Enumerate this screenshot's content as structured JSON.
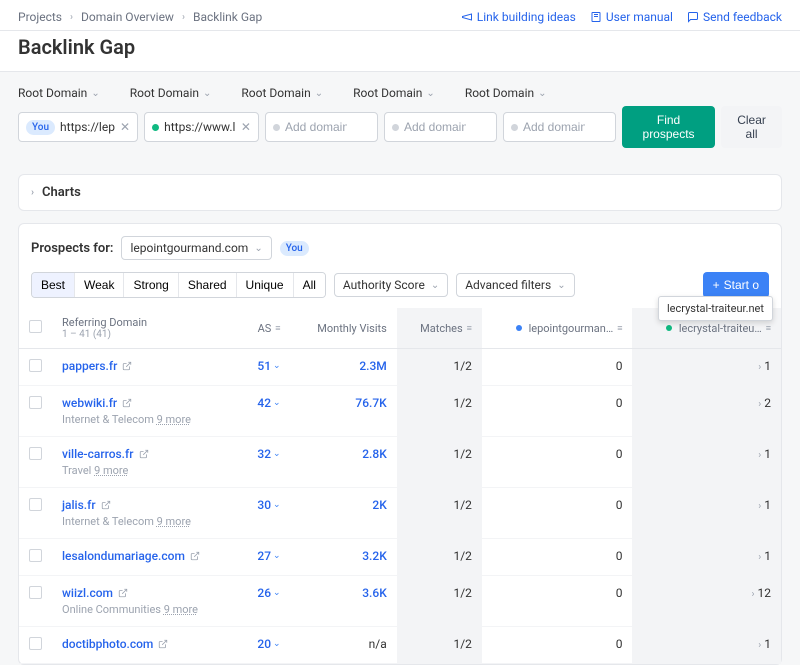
{
  "breadcrumbs": [
    "Projects",
    "Domain Overview",
    "Backlink Gap"
  ],
  "title": "Backlink Gap",
  "topLinks": {
    "ideas": "Link building ideas",
    "manual": "User manual",
    "feedback": "Send feedback"
  },
  "selectorLabel": "Root Domain",
  "youBadge": "You",
  "domainInputs": [
    {
      "value": "https://lep…",
      "filled": true,
      "color": "you"
    },
    {
      "value": "https://www.l…",
      "filled": true,
      "color": "green"
    },
    {
      "placeholder": "Add domain",
      "filled": false
    },
    {
      "placeholder": "Add domain",
      "filled": false
    },
    {
      "placeholder": "Add domain",
      "filled": false
    }
  ],
  "buttons": {
    "find": "Find prospects",
    "clear": "Clear all",
    "start": "Start o"
  },
  "chartsLabel": "Charts",
  "prospects": {
    "label": "Prospects for:",
    "domain": "lepointgourmand.com"
  },
  "segments": [
    "Best",
    "Weak",
    "Strong",
    "Shared",
    "Unique",
    "All"
  ],
  "filtersDD": {
    "authority": "Authority Score",
    "advanced": "Advanced filters"
  },
  "tooltip": "lecrystal-traiteur.net",
  "columns": {
    "domain": "Referring Domain",
    "domainSub": "1 – 41 (41)",
    "as": "AS",
    "visits": "Monthly Visits",
    "matches": "Matches",
    "c1": "lepointgourman…",
    "c2": "lecrystal-traiteu…"
  },
  "rows": [
    {
      "d": "pappers.fr",
      "meta": "",
      "as": "51",
      "v": "2.3M",
      "m": "1/2",
      "c1": "0",
      "c2": "1"
    },
    {
      "d": "webwiki.fr",
      "meta": "Internet & Telecom 9 more",
      "as": "42",
      "v": "76.7K",
      "m": "1/2",
      "c1": "0",
      "c2": "2"
    },
    {
      "d": "ville-carros.fr",
      "meta": "Travel 9 more",
      "as": "32",
      "v": "2.8K",
      "m": "1/2",
      "c1": "0",
      "c2": "1"
    },
    {
      "d": "jalis.fr",
      "meta": "Internet & Telecom 9 more",
      "as": "30",
      "v": "2K",
      "m": "1/2",
      "c1": "0",
      "c2": "1"
    },
    {
      "d": "lesalondumariage.com",
      "meta": "",
      "as": "27",
      "v": "3.2K",
      "m": "1/2",
      "c1": "0",
      "c2": "1"
    },
    {
      "d": "wiizl.com",
      "meta": "Online Communities 9 more",
      "as": "26",
      "v": "3.6K",
      "m": "1/2",
      "c1": "0",
      "c2": "12"
    },
    {
      "d": "doctibphoto.com",
      "meta": "",
      "as": "20",
      "v": "n/a",
      "m": "1/2",
      "c1": "0",
      "c2": "1"
    }
  ]
}
